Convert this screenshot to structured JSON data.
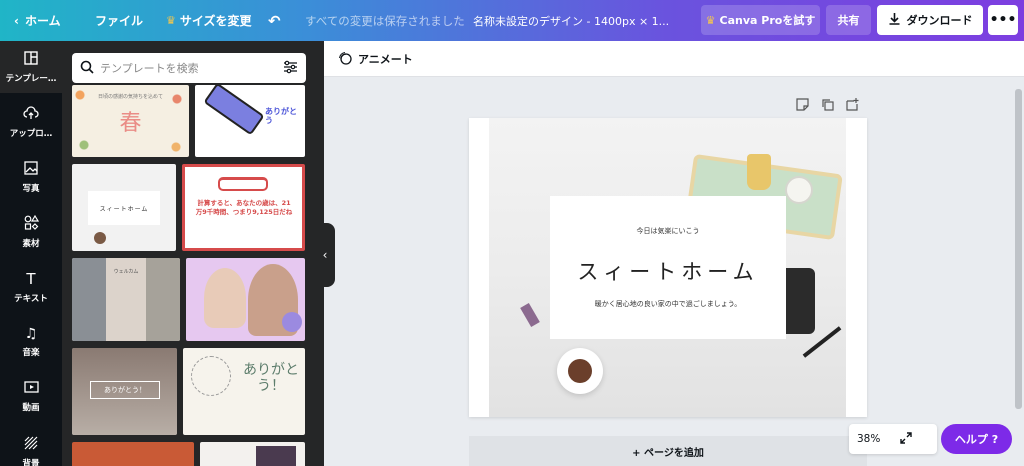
{
  "topbar": {
    "home_label": "ホーム",
    "file_label": "ファイル",
    "resize_label": "サイズを変更",
    "saved_status": "すべての変更は保存されました",
    "design_title": "名称未設定のデザイン - 1400px × 1...",
    "pro_label": "Canva Proを試す",
    "share_label": "共有",
    "download_label": "ダウンロード",
    "more_label": "•••"
  },
  "rail": {
    "items": [
      {
        "label": "テンプレー…",
        "icon": "template-icon"
      },
      {
        "label": "アップロ…",
        "icon": "upload-icon"
      },
      {
        "label": "写真",
        "icon": "photo-icon"
      },
      {
        "label": "素材",
        "icon": "elements-icon"
      },
      {
        "label": "テキスト",
        "icon": "text-icon"
      },
      {
        "label": "音楽",
        "icon": "music-icon"
      },
      {
        "label": "動画",
        "icon": "video-icon"
      },
      {
        "label": "背景",
        "icon": "background-icon"
      }
    ]
  },
  "panel": {
    "search_placeholder": "テンプレートを検索",
    "thumbs": [
      {
        "text": "春",
        "sub": "日頃の感謝の気持ちを込めて"
      },
      {
        "text": "ありがとう"
      },
      {
        "text": "スィートホーム"
      },
      {
        "text": "計算すると、あなたの歳は、21万9千時間、つまり9,125日だね"
      },
      {
        "text": "ウェルカム"
      },
      {
        "text": ""
      },
      {
        "text": "ありがとう！"
      },
      {
        "text": "ありがとう！"
      }
    ]
  },
  "subbar": {
    "animate_label": "アニメート"
  },
  "design": {
    "subtitle": "今日は気楽にいこう",
    "title": "スィートホーム",
    "body": "暖かく居心地の良い家の中で過ごしましょう。"
  },
  "footer": {
    "add_page_label": "+ ページを追加",
    "zoom_value": "38%",
    "help_label": "ヘルプ ?"
  },
  "colors": {
    "accent": "#7d2ae8",
    "dark": "#0e1318",
    "panel": "#252627"
  }
}
